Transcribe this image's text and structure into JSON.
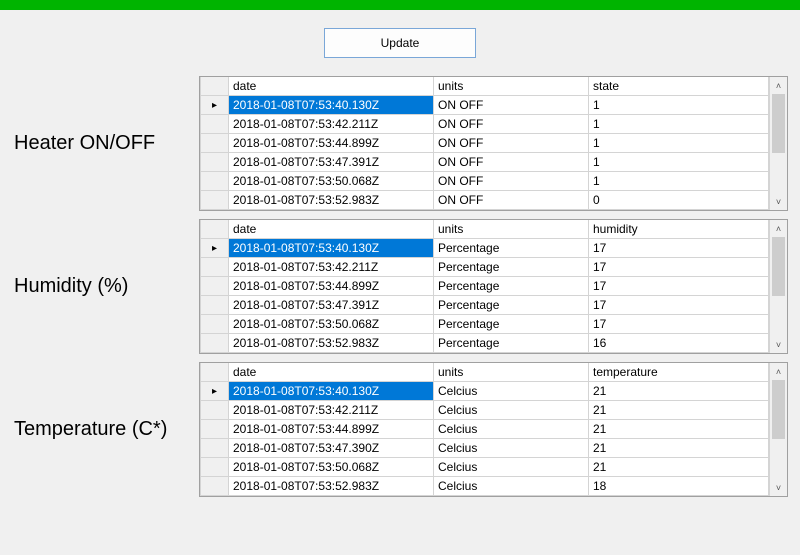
{
  "update_button_label": "Update",
  "panels": [
    {
      "label": "Heater ON/OFF",
      "columns": [
        "date",
        "units",
        "state"
      ],
      "rows": [
        {
          "date": "2018-01-08T07:53:40.130Z",
          "units": "ON OFF",
          "value": "1",
          "selected": true,
          "current": true
        },
        {
          "date": "2018-01-08T07:53:42.211Z",
          "units": "ON OFF",
          "value": "1"
        },
        {
          "date": "2018-01-08T07:53:44.899Z",
          "units": "ON OFF",
          "value": "1"
        },
        {
          "date": "2018-01-08T07:53:47.391Z",
          "units": "ON OFF",
          "value": "1"
        },
        {
          "date": "2018-01-08T07:53:50.068Z",
          "units": "ON OFF",
          "value": "1"
        },
        {
          "date": "2018-01-08T07:53:52.983Z",
          "units": "ON OFF",
          "value": "0"
        }
      ]
    },
    {
      "label": "Humidity (%)",
      "columns": [
        "date",
        "units",
        "humidity"
      ],
      "rows": [
        {
          "date": "2018-01-08T07:53:40.130Z",
          "units": "Percentage",
          "value": "17",
          "selected": true,
          "current": true
        },
        {
          "date": "2018-01-08T07:53:42.211Z",
          "units": "Percentage",
          "value": "17"
        },
        {
          "date": "2018-01-08T07:53:44.899Z",
          "units": "Percentage",
          "value": "17"
        },
        {
          "date": "2018-01-08T07:53:47.391Z",
          "units": "Percentage",
          "value": "17"
        },
        {
          "date": "2018-01-08T07:53:50.068Z",
          "units": "Percentage",
          "value": "17"
        },
        {
          "date": "2018-01-08T07:53:52.983Z",
          "units": "Percentage",
          "value": "16"
        }
      ]
    },
    {
      "label": "Temperature (C*)",
      "columns": [
        "date",
        "units",
        "temperature"
      ],
      "rows": [
        {
          "date": "2018-01-08T07:53:40.130Z",
          "units": "Celcius",
          "value": "21",
          "selected": true,
          "current": true
        },
        {
          "date": "2018-01-08T07:53:42.211Z",
          "units": "Celcius",
          "value": "21"
        },
        {
          "date": "2018-01-08T07:53:44.899Z",
          "units": "Celcius",
          "value": "21"
        },
        {
          "date": "2018-01-08T07:53:47.390Z",
          "units": "Celcius",
          "value": "21"
        },
        {
          "date": "2018-01-08T07:53:50.068Z",
          "units": "Celcius",
          "value": "21"
        },
        {
          "date": "2018-01-08T07:53:52.983Z",
          "units": "Celcius",
          "value": "18"
        }
      ]
    }
  ]
}
